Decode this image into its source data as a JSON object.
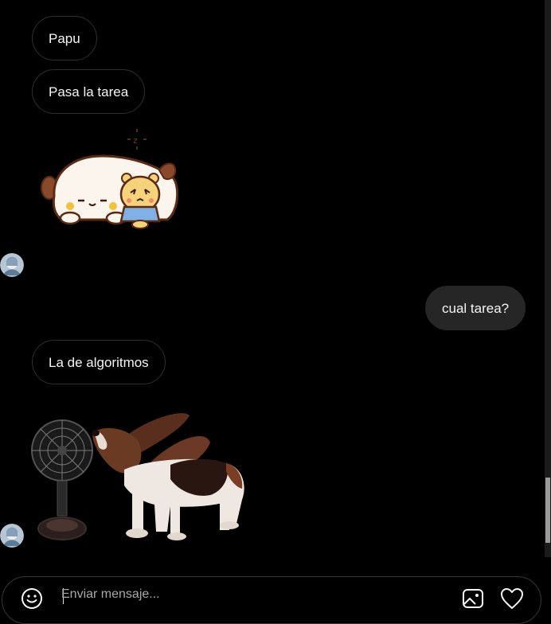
{
  "conversation": {
    "messages": [
      {
        "direction": "in",
        "text": "Papu"
      },
      {
        "direction": "in",
        "text": "Pasa la tarea"
      },
      {
        "direction": "in",
        "sticker": "sleeping-dog-and-hamster-sticker"
      },
      {
        "direction": "out",
        "text": "cual tarea?"
      },
      {
        "direction": "in",
        "text": "La de algoritmos"
      },
      {
        "direction": "in",
        "sticker": "basset-hound-with-fan-sticker"
      }
    ]
  },
  "composer": {
    "placeholder": "Enviar mensaje...",
    "value": "",
    "icons": {
      "emoji": "smiley-face-icon",
      "gallery": "image-icon",
      "like": "heart-icon"
    }
  },
  "colors": {
    "background": "#000000",
    "incoming_border": "#2e2e2e",
    "outgoing_bubble": "#262626",
    "text": "#f5f5f5",
    "placeholder": "#a8a8a8"
  }
}
